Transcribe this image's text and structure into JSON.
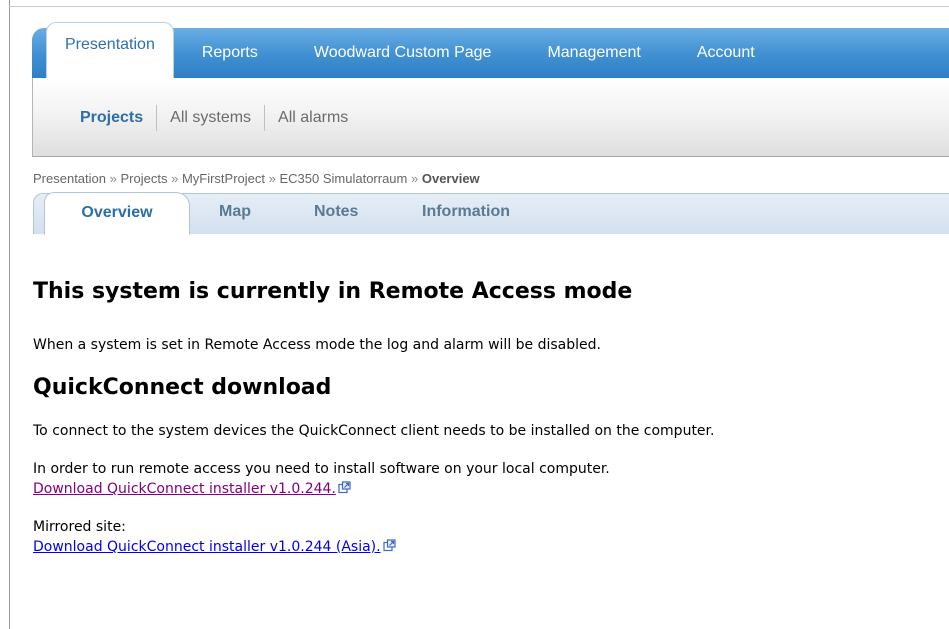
{
  "main_nav": {
    "tabs": [
      {
        "label": "Presentation",
        "active": true
      },
      {
        "label": "Reports",
        "active": false
      },
      {
        "label": "Woodward Custom Page",
        "active": false
      },
      {
        "label": "Management",
        "active": false
      },
      {
        "label": "Account",
        "active": false
      }
    ]
  },
  "sub_nav": {
    "items": [
      {
        "label": "Projects",
        "active": true
      },
      {
        "label": "All systems",
        "active": false
      },
      {
        "label": "All alarms",
        "active": false
      }
    ]
  },
  "breadcrumb": {
    "items": [
      "Presentation",
      "Projects",
      "MyFirstProject",
      "EC350 Simulatorraum"
    ],
    "separator": "»",
    "current": "Overview"
  },
  "page_tabs": {
    "tabs": [
      {
        "label": "Overview",
        "active": true
      },
      {
        "label": "Map",
        "active": false
      },
      {
        "label": "Notes",
        "active": false
      },
      {
        "label": "Information",
        "active": false
      }
    ]
  },
  "content": {
    "remote_heading": "This system is currently in Remote Access mode",
    "remote_text": "When a system is set in Remote Access mode the log and alarm will be disabled.",
    "qc_heading": "QuickConnect download",
    "qc_text": "To connect to the system devices the QuickConnect client needs to be installed on the computer.",
    "install_text": "In order to run remote access you need to install software on your local computer.",
    "download_link": "Download QuickConnect installer v1.0.244.",
    "mirror_label": "Mirrored site:",
    "mirror_link": "Download QuickConnect installer v1.0.244 (Asia)."
  },
  "icons": {
    "external_link": "external-link-icon"
  },
  "colors": {
    "nav_blue": "#3f8fd2",
    "active_tab_text": "#2f6fb4",
    "visited_link": "#800080",
    "link": "#0000ee"
  }
}
